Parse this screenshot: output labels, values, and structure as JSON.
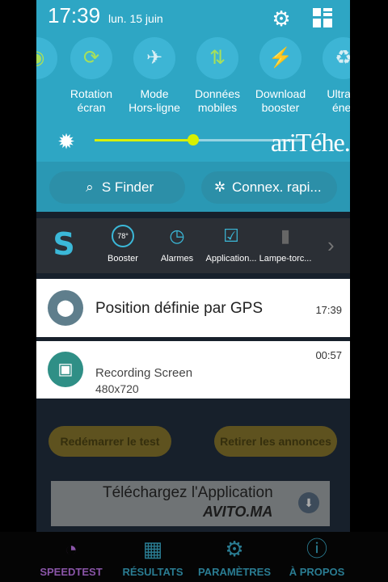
{
  "status_bar": {
    "time": "17:39",
    "date": "lun. 15 juin"
  },
  "quick_settings": [
    {
      "label": "",
      "icon": "partial-toggle-icon"
    },
    {
      "label": "Rotation\nécran",
      "icon": "rotation-icon"
    },
    {
      "label": "Mode\nHors-ligne",
      "icon": "airplane-icon"
    },
    {
      "label": "Données\nmobiles",
      "icon": "data-arrows-icon"
    },
    {
      "label": "Download\nbooster",
      "icon": "download-booster-icon"
    },
    {
      "label": "Ultra é\néner",
      "icon": "power-saving-icon"
    }
  ],
  "brightness": {
    "level": 0.47,
    "watermark": "ariTéhe.net"
  },
  "panel_buttons": {
    "sfinder": "S Finder",
    "connex": "Connex. rapi..."
  },
  "apps_row": [
    {
      "label": "Booster",
      "icon": "booster-icon",
      "badge": "78°"
    },
    {
      "label": "Alarmes",
      "icon": "clock-icon"
    },
    {
      "label": "Application...",
      "icon": "task-list-icon"
    },
    {
      "label": "Lampe-torc...",
      "icon": "flashlight-icon"
    }
  ],
  "notifications": [
    {
      "title": "Position définie par GPS",
      "time": "17:39",
      "icon": "location-icon"
    },
    {
      "title": "Recording Screen",
      "subtitle": "480x720",
      "time": "00:57",
      "icon": "screen-recorder-icon"
    }
  ],
  "background_buttons": {
    "restart": "Redémarrer le test",
    "remove_ads": "Retirer les annonces"
  },
  "ad": {
    "text": "Téléchargez l'Application",
    "brand": "AVITO.MA"
  },
  "nav": [
    {
      "label": "SPEEDTEST",
      "icon": "speedometer-icon"
    },
    {
      "label": "RÉSULTATS",
      "icon": "folder-icon"
    },
    {
      "label": "PARAMÈTRES",
      "icon": "gear-icon"
    },
    {
      "label": "À PROPOS",
      "icon": "info-icon"
    }
  ]
}
